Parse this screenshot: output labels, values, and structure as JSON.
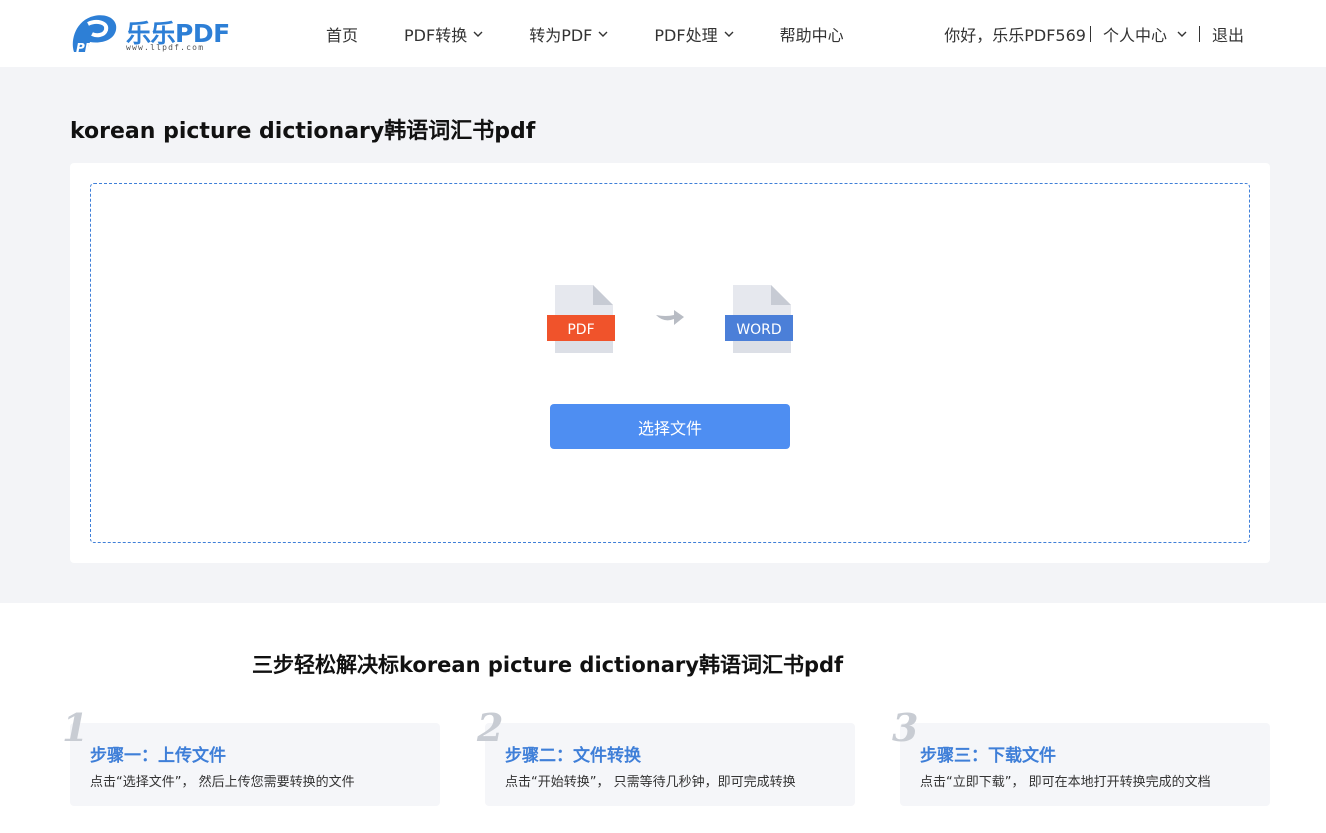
{
  "header": {
    "logo_text": "乐乐PDF",
    "logo_url": "www.llpdf.com",
    "logo_mark": "PDF",
    "nav": [
      {
        "label": "首页",
        "has_dropdown": false
      },
      {
        "label": "PDF转换",
        "has_dropdown": true
      },
      {
        "label": "转为PDF",
        "has_dropdown": true
      },
      {
        "label": "PDF处理",
        "has_dropdown": true
      },
      {
        "label": "帮助中心",
        "has_dropdown": false
      }
    ],
    "greeting": "你好，乐乐PDF569",
    "user_center": "个人中心",
    "logout": "退出"
  },
  "main": {
    "title": "korean picture dictionary韩语词汇书pdf",
    "pdf_icon_label": "PDF",
    "word_icon_label": "WORD",
    "select_button": "选择文件"
  },
  "steps": {
    "title": "三步轻松解决标korean picture dictionary韩语词汇书pdf",
    "items": [
      {
        "num": "1",
        "title": "步骤一：上传文件",
        "desc": "点击“选择文件”， 然后上传您需要转换的文件"
      },
      {
        "num": "2",
        "title": "步骤二：文件转换",
        "desc": "点击“开始转换”， 只需等待几秒钟，即可完成转换"
      },
      {
        "num": "3",
        "title": "步骤三：下载文件",
        "desc": "点击“立即下载”， 即可在本地打开转换完成的文档"
      }
    ]
  },
  "colors": {
    "brand": "#2d7fd6",
    "button": "#4e8ef2",
    "pdf": "#f0532b",
    "word": "#4b7fd8",
    "step_title": "#3f7fd8"
  }
}
